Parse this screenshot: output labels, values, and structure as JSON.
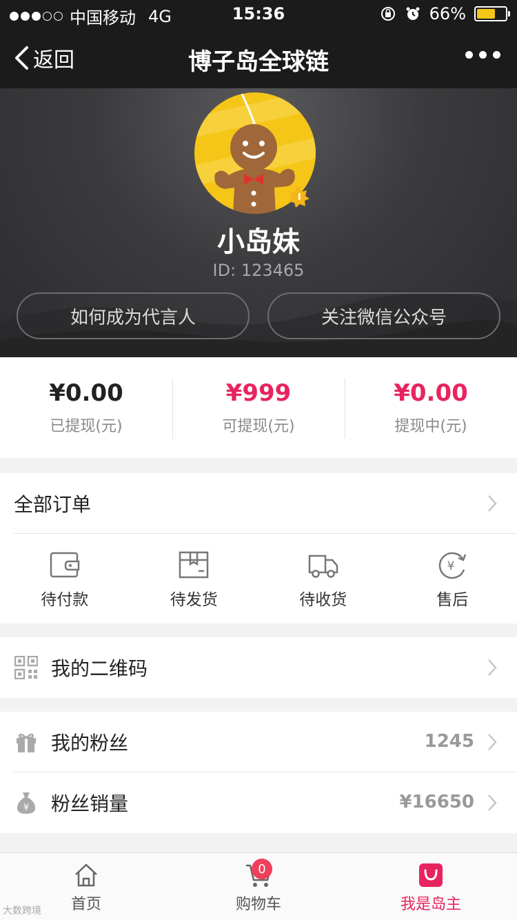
{
  "status_bar": {
    "carrier": "中国移动",
    "network": "4G",
    "time": "15:36",
    "battery": "66%",
    "battery_level": 0.66
  },
  "nav": {
    "back_label": "返回",
    "title": "博子岛全球链"
  },
  "profile": {
    "name": "小岛妹",
    "id_text": "ID: 123465",
    "button_left": "如何成为代言人",
    "button_right": "关注微信公众号"
  },
  "stats": [
    {
      "value": "¥0.00",
      "label": "已提现(元)"
    },
    {
      "value": "¥999",
      "label": "可提现(元)"
    },
    {
      "value": "¥0.00",
      "label": "提现中(元)"
    }
  ],
  "orders": {
    "title": "全部订单",
    "items": [
      {
        "label": "待付款",
        "icon": "wallet-icon"
      },
      {
        "label": "待发货",
        "icon": "box-icon"
      },
      {
        "label": "待收货",
        "icon": "truck-icon"
      },
      {
        "label": "售后",
        "icon": "refund-icon"
      }
    ]
  },
  "qrcode": {
    "label": "我的二维码",
    "icon": "qrcode-icon"
  },
  "fans": {
    "label": "我的粉丝",
    "value": "1245",
    "icon": "gift-icon"
  },
  "fan_sales": {
    "label": "粉丝销量",
    "value": "¥16650",
    "icon": "money-bag-icon"
  },
  "tabs": [
    {
      "label": "首页",
      "icon": "home-icon"
    },
    {
      "label": "购物车",
      "icon": "cart-icon",
      "badge": "0"
    },
    {
      "label": "我是岛主",
      "icon": "bag-icon"
    }
  ],
  "watermark": "大数跨境",
  "colors": {
    "accent": "#e8245f",
    "dark": "#1b1b1c"
  }
}
